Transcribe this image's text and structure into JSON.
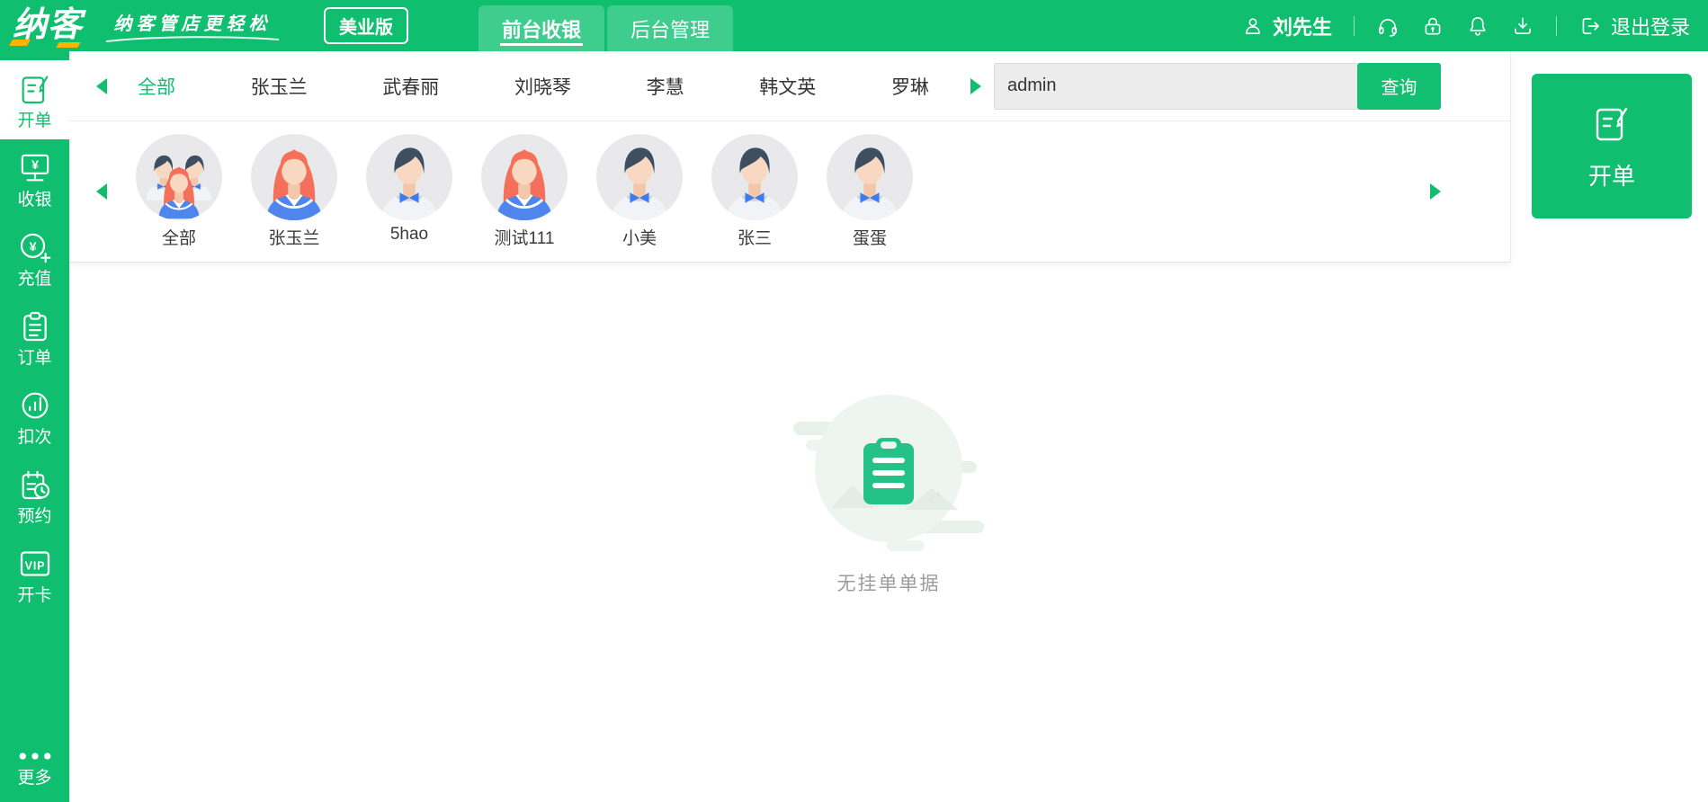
{
  "topbar": {
    "logo_text": "纳客",
    "slogan": "纳客管店更轻松",
    "edition_badge": "美业版",
    "tabs": [
      {
        "label": "前台收银",
        "active": true
      },
      {
        "label": "后台管理",
        "active": false
      }
    ],
    "user_name": "刘先生",
    "logout_label": "退出登录",
    "right_icons": [
      "user-icon",
      "headset-icon",
      "lock-icon",
      "bell-icon",
      "download-icon",
      "logout-icon"
    ]
  },
  "sidebar": {
    "items": [
      {
        "label": "开单",
        "icon": "billing-pad-icon",
        "active": true
      },
      {
        "label": "收银",
        "icon": "cashier-icon",
        "active": false
      },
      {
        "label": "充值",
        "icon": "recharge-icon",
        "active": false
      },
      {
        "label": "订单",
        "icon": "orders-icon",
        "active": false
      },
      {
        "label": "扣次",
        "icon": "deduct-count-icon",
        "active": false
      },
      {
        "label": "预约",
        "icon": "appointment-icon",
        "active": false
      },
      {
        "label": "开卡",
        "icon": "vip-card-icon",
        "active": false
      }
    ],
    "more_label": "更多",
    "more_icon": "more-dots-icon"
  },
  "staff_bar": {
    "tabs": [
      {
        "label": "全部",
        "active": true
      },
      {
        "label": "张玉兰",
        "active": false
      },
      {
        "label": "武春丽",
        "active": false
      },
      {
        "label": "刘晓琴",
        "active": false
      },
      {
        "label": "李慧",
        "active": false
      },
      {
        "label": "韩文英",
        "active": false
      },
      {
        "label": "罗琳",
        "active": false
      }
    ],
    "search_value": "admin",
    "search_button": "查询"
  },
  "staff_avatars": [
    {
      "label": "全部",
      "type": "group"
    },
    {
      "label": "张玉兰",
      "type": "female"
    },
    {
      "label": "5hao",
      "type": "male"
    },
    {
      "label": "测试111",
      "type": "female"
    },
    {
      "label": "小美",
      "type": "male"
    },
    {
      "label": "张三",
      "type": "male"
    },
    {
      "label": "蛋蛋",
      "type": "male"
    }
  ],
  "open_bill_card": {
    "label": "开单",
    "icon": "billing-pad-icon"
  },
  "empty_state": {
    "message": "无挂单单据",
    "icon": "clipboard-icon"
  },
  "colors": {
    "brand_green": "#0fbe6e",
    "tab_green": "#3ecd8d",
    "accent_yellow": "#f7b500",
    "button_green": "#13bf70",
    "avatar_bg": "#e9e9ec",
    "empty_circle": "#eef4ef"
  }
}
